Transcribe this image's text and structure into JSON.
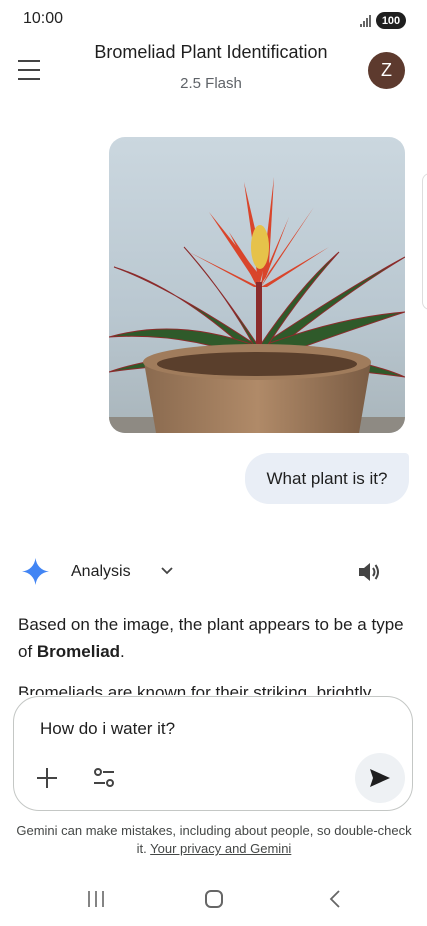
{
  "status_bar": {
    "time": "10:00",
    "battery": "100"
  },
  "header": {
    "title": "Bromeliad Plant Identification",
    "model": "2.5 Flash",
    "avatar_letter": "Z"
  },
  "user_message": {
    "text": "What plant is it?"
  },
  "response": {
    "label": "Analysis",
    "p1_before": "Based on the image, the plant appears to be a type of ",
    "p1_bold": "Bromeliad",
    "p1_after": ".",
    "p2_partial": "Bromeliads are known for their striking, brightly"
  },
  "input": {
    "value": "How do i water it?"
  },
  "disclaimer": {
    "text": "Gemini can make mistakes, including about people, so double-check it. ",
    "link": "Your privacy and Gemini"
  },
  "colors": {
    "accent_blue": "#4285f4",
    "avatar_bg": "#5d3a2e",
    "bubble_bg": "#e9eef6"
  },
  "icons": [
    "menu-icon",
    "gemini-star-icon",
    "chevron-down-icon",
    "speaker-icon",
    "plus-icon",
    "tools-icon",
    "send-icon",
    "recents-icon",
    "home-icon",
    "back-icon"
  ]
}
